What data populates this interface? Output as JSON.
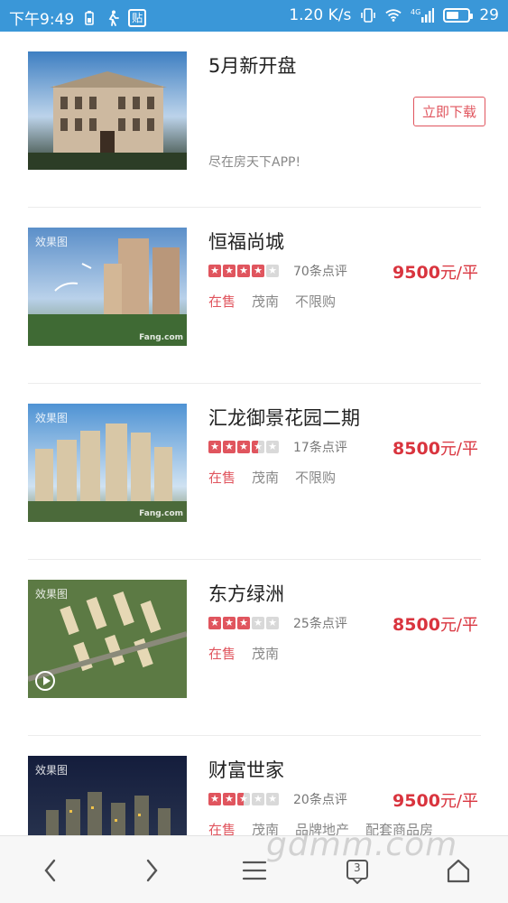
{
  "status_bar": {
    "time": "下午9:49",
    "tie_icon": "贴",
    "speed": "1.20 K/s",
    "network": "4G",
    "battery": "29"
  },
  "ad": {
    "title": "5月新开盘",
    "button_label": "立即下载",
    "subtitle": "尽在房天下APP!"
  },
  "listings": [
    {
      "name": "恒福尚城",
      "stars": 4,
      "reviews": "70条点评",
      "price": "9500",
      "price_unit": "元/平",
      "tags": [
        "在售",
        "茂南",
        "不限购"
      ],
      "image_tag": "效果图",
      "image_wm": "Fang.com"
    },
    {
      "name": "汇龙御景花园二期",
      "stars": 3.5,
      "reviews": "17条点评",
      "price": "8500",
      "price_unit": "元/平",
      "tags": [
        "在售",
        "茂南",
        "不限购"
      ],
      "image_tag": "效果图",
      "image_wm": "Fang.com"
    },
    {
      "name": "东方绿洲",
      "stars": 3,
      "reviews": "25条点评",
      "price": "8500",
      "price_unit": "元/平",
      "tags": [
        "在售",
        "茂南"
      ],
      "image_tag": "效果图",
      "image_wm": ""
    },
    {
      "name": "财富世家",
      "stars": 2.5,
      "reviews": "20条点评",
      "price": "9500",
      "price_unit": "元/平",
      "tags": [
        "在售",
        "茂南",
        "品牌地产",
        "配套商品房"
      ],
      "image_tag": "效果图",
      "image_wm": ""
    }
  ],
  "bottom_nav": {
    "tab_count": "3",
    "icons": [
      "back-arrow-icon",
      "forward-arrow-icon",
      "menu-icon",
      "tabs-icon",
      "home-icon"
    ]
  },
  "watermark": "gdmm.com",
  "colors": {
    "status_bar": "#3a97d8",
    "accent": "#e0555e",
    "price": "#d9343e"
  }
}
